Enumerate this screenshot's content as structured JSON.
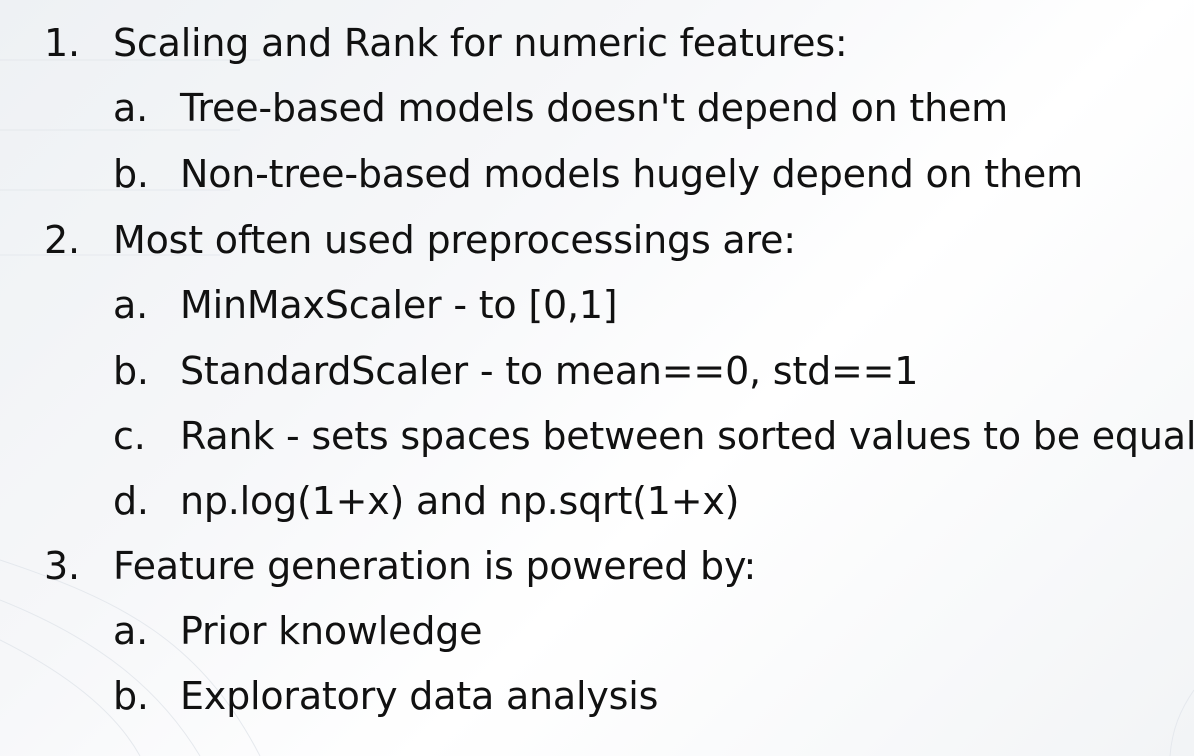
{
  "slide": {
    "sections": [
      {
        "number": "1.",
        "text": "Scaling and Rank for numeric features:",
        "items": [
          {
            "letter": "a.",
            "text": "Tree-based models doesn't depend on them"
          },
          {
            "letter": "b.",
            "text": "Non-tree-based models hugely depend on them"
          }
        ]
      },
      {
        "number": "2.",
        "text": "Most often used preprocessings are:",
        "items": [
          {
            "letter": "a.",
            "text": "MinMaxScaler - to [0,1]"
          },
          {
            "letter": "b.",
            "text": "StandardScaler - to mean==0, std==1"
          },
          {
            "letter": "c.",
            "text": "Rank - sets spaces between sorted values to be equal"
          },
          {
            "letter": "d.",
            "text": "np.log(1+x) and np.sqrt(1+x)"
          }
        ]
      },
      {
        "number": "3.",
        "text": "Feature generation is powered by:",
        "items": [
          {
            "letter": "a.",
            "text": "Prior knowledge"
          },
          {
            "letter": "b.",
            "text": "Exploratory data analysis"
          }
        ]
      }
    ]
  }
}
